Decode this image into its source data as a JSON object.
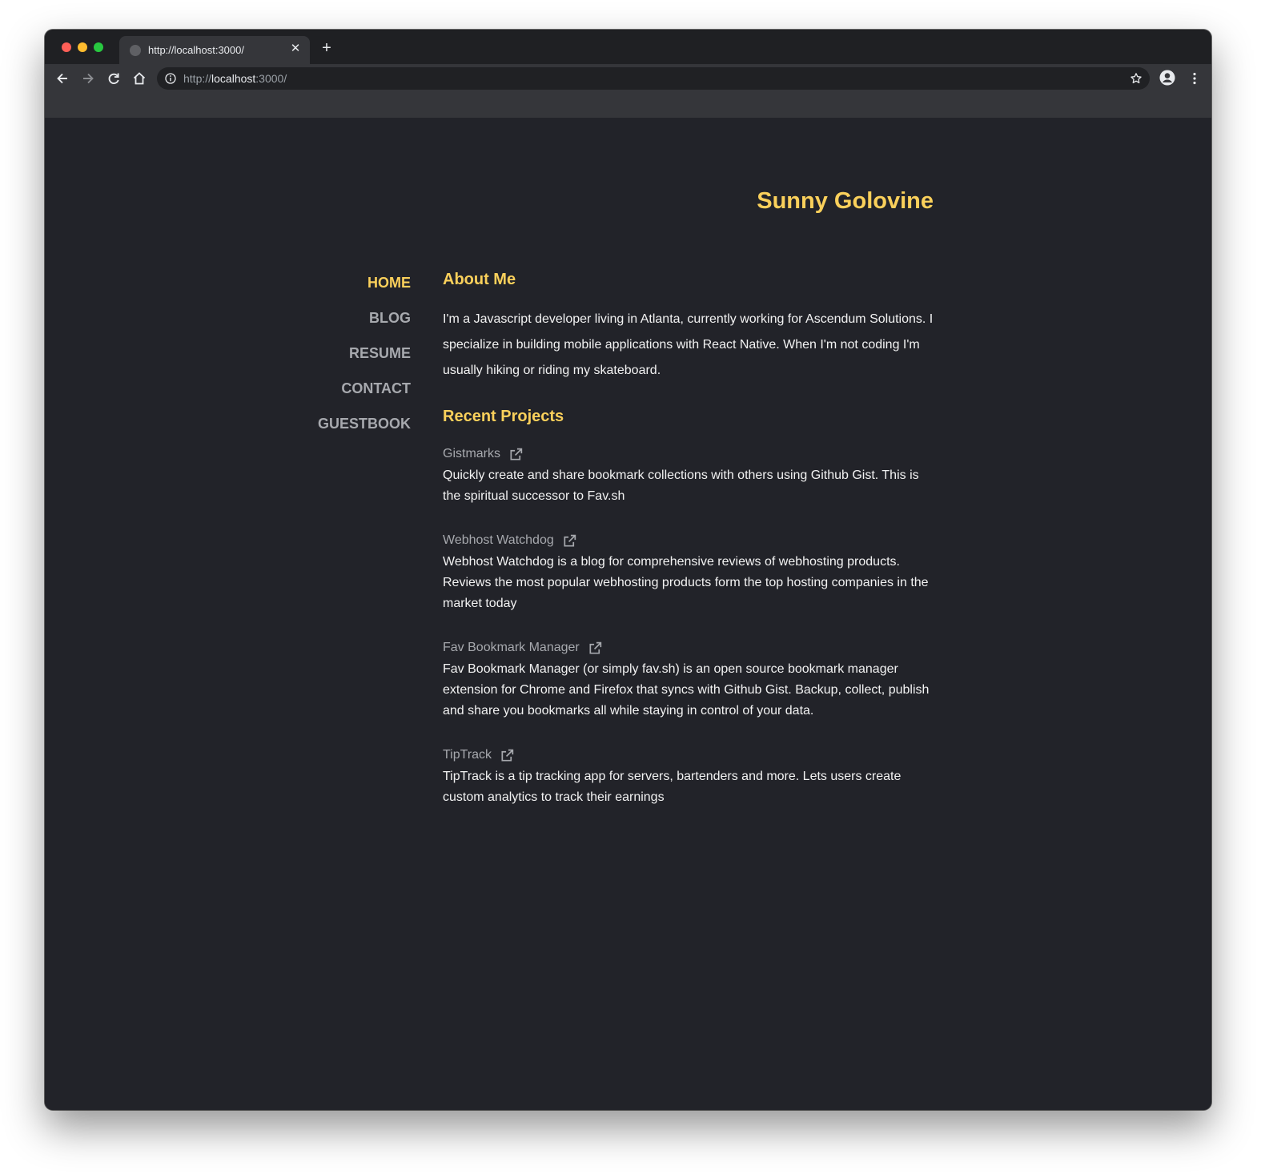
{
  "browser": {
    "tab_title": "http://localhost:3000/",
    "tab_close_icon": "close-icon",
    "new_tab_icon": "plus-icon",
    "url_scheme": "http://",
    "url_host": "localhost",
    "url_rest": ":3000/",
    "icons": [
      "back-arrow-icon",
      "forward-arrow-icon",
      "reload-icon",
      "home-icon",
      "info-icon",
      "star-icon",
      "account-icon",
      "kebab-menu-icon"
    ]
  },
  "site": {
    "title": "Sunny Golovine",
    "accent_color": "#fad05b",
    "background_color": "#222329"
  },
  "nav": {
    "items": [
      {
        "label": "HOME",
        "active": true
      },
      {
        "label": "BLOG",
        "active": false
      },
      {
        "label": "RESUME",
        "active": false
      },
      {
        "label": "CONTACT",
        "active": false
      },
      {
        "label": "GUESTBOOK",
        "active": false
      }
    ]
  },
  "about": {
    "heading": "About Me",
    "text": "I'm a Javascript developer living in Atlanta, currently working for Ascendum Solutions. I specialize in building mobile applications with React Native. When I'm not coding I'm usually hiking or riding my skateboard."
  },
  "projects": {
    "heading": "Recent Projects",
    "external_link_icon": "external-link-icon",
    "items": [
      {
        "title": "Gistmarks",
        "description": "Quickly create and share bookmark collections with others using Github Gist. This is the spiritual successor to Fav.sh"
      },
      {
        "title": "Webhost Watchdog",
        "description": "Webhost Watchdog is a blog for comprehensive reviews of webhosting products. Reviews the most popular webhosting products form the top hosting companies in the market today"
      },
      {
        "title": "Fav Bookmark Manager",
        "description": "Fav Bookmark Manager (or simply fav.sh) is an open source bookmark manager extension for Chrome and Firefox that syncs with Github Gist. Backup, collect, publish and share you bookmarks all while staying in control of your data."
      },
      {
        "title": "TipTrack",
        "description": "TipTrack is a tip tracking app for servers, bartenders and more. Lets users create custom analytics to track their earnings"
      }
    ]
  }
}
